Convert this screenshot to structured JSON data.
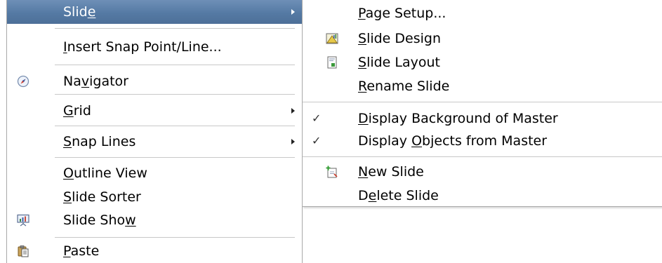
{
  "main_menu": {
    "items": [
      {
        "pre": "Slid",
        "key": "e",
        "post": "",
        "highlighted": true,
        "submenu": true
      },
      {
        "pre": "",
        "key": "I",
        "post": "nsert Snap Point/Line...",
        "icon": null
      },
      {
        "pre": "Na",
        "key": "v",
        "post": "igator",
        "icon": "navigator-compass-icon"
      },
      {
        "pre": "",
        "key": "G",
        "post": "rid",
        "submenu": true
      },
      {
        "pre": "",
        "key": "S",
        "post": "nap Lines",
        "submenu": true
      },
      {
        "pre": "",
        "key": "O",
        "post": "utline View"
      },
      {
        "pre": "",
        "key": "S",
        "post": "lide Sorter"
      },
      {
        "pre": "Slide Sho",
        "key": "w",
        "post": "",
        "icon": "slide-show-icon"
      },
      {
        "pre": "",
        "key": "P",
        "post": "aste",
        "icon": "paste-icon"
      }
    ]
  },
  "sub_menu": {
    "items": [
      {
        "pre": "",
        "key": "P",
        "post": "age Setup..."
      },
      {
        "pre": "",
        "key": "S",
        "post": "lide Design",
        "icon": "slide-design-icon"
      },
      {
        "pre": "",
        "key": "S",
        "post": "lide Layout",
        "icon": "slide-layout-icon"
      },
      {
        "pre": "",
        "key": "R",
        "post": "ename Slide"
      },
      {
        "pre": "",
        "key": "D",
        "post": "isplay Background of Master",
        "checked": true
      },
      {
        "pre": "Display ",
        "key": "O",
        "post": "bjects from Master",
        "checked": true
      },
      {
        "pre": "",
        "key": "N",
        "post": "ew Slide",
        "icon": "new-slide-icon"
      },
      {
        "pre": "D",
        "key": "e",
        "post": "lete Slide"
      }
    ]
  },
  "check_glyph": "✓"
}
